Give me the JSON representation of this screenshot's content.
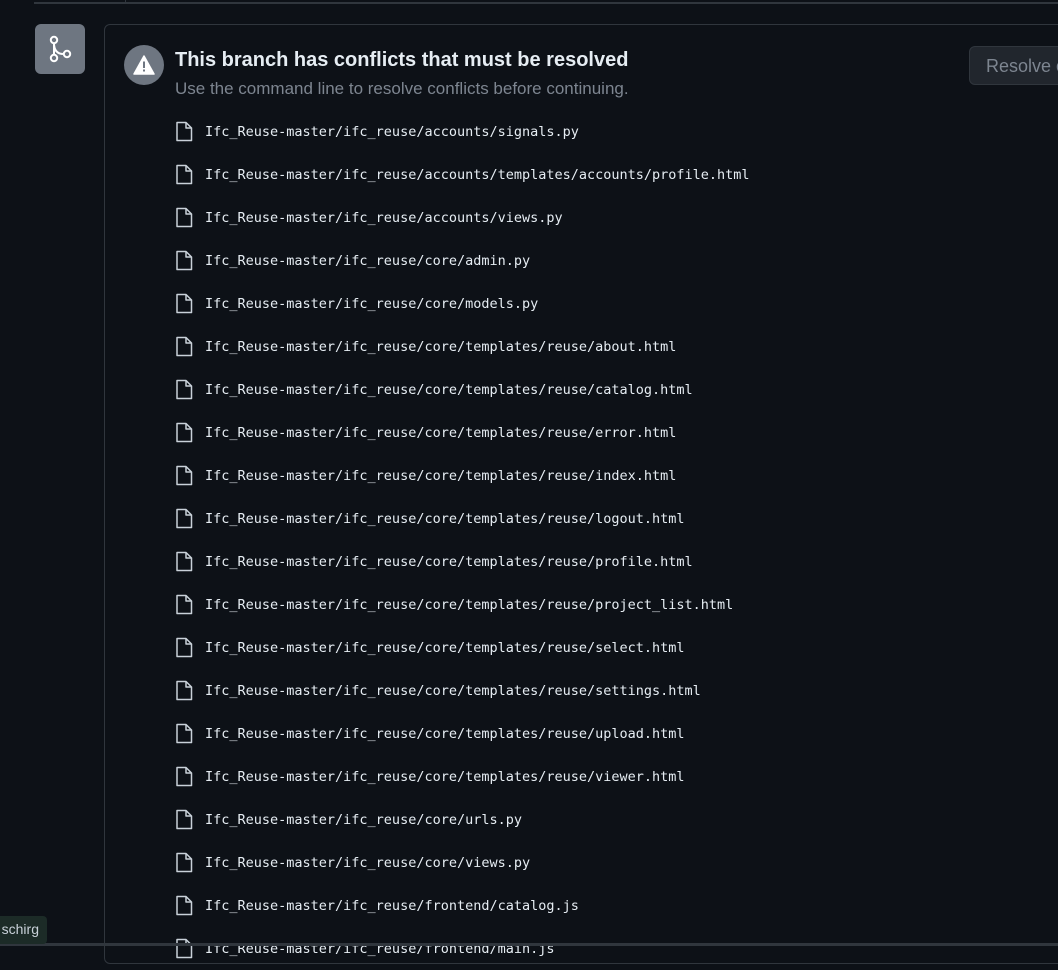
{
  "conflict": {
    "title": "This branch has conflicts that must be resolved",
    "subtitle": "Use the command line to resolve conflicts before continuing.",
    "resolve_button": "Resolve c"
  },
  "files": [
    "Ifc_Reuse-master/ifc_reuse/accounts/signals.py",
    "Ifc_Reuse-master/ifc_reuse/accounts/templates/accounts/profile.html",
    "Ifc_Reuse-master/ifc_reuse/accounts/views.py",
    "Ifc_Reuse-master/ifc_reuse/core/admin.py",
    "Ifc_Reuse-master/ifc_reuse/core/models.py",
    "Ifc_Reuse-master/ifc_reuse/core/templates/reuse/about.html",
    "Ifc_Reuse-master/ifc_reuse/core/templates/reuse/catalog.html",
    "Ifc_Reuse-master/ifc_reuse/core/templates/reuse/error.html",
    "Ifc_Reuse-master/ifc_reuse/core/templates/reuse/index.html",
    "Ifc_Reuse-master/ifc_reuse/core/templates/reuse/logout.html",
    "Ifc_Reuse-master/ifc_reuse/core/templates/reuse/profile.html",
    "Ifc_Reuse-master/ifc_reuse/core/templates/reuse/project_list.html",
    "Ifc_Reuse-master/ifc_reuse/core/templates/reuse/select.html",
    "Ifc_Reuse-master/ifc_reuse/core/templates/reuse/settings.html",
    "Ifc_Reuse-master/ifc_reuse/core/templates/reuse/upload.html",
    "Ifc_Reuse-master/ifc_reuse/core/templates/reuse/viewer.html",
    "Ifc_Reuse-master/ifc_reuse/core/urls.py",
    "Ifc_Reuse-master/ifc_reuse/core/views.py",
    "Ifc_Reuse-master/ifc_reuse/frontend/catalog.js",
    "Ifc_Reuse-master/ifc_reuse/frontend/main.js"
  ],
  "user_tag": "schirg",
  "icons": {
    "merge": "git-merge-icon",
    "warning": "alert-icon",
    "file": "file-icon"
  },
  "colors": {
    "background": "#0d1117",
    "border": "#30363d",
    "badge": "#6e7681",
    "muted_text": "#7d8590"
  }
}
